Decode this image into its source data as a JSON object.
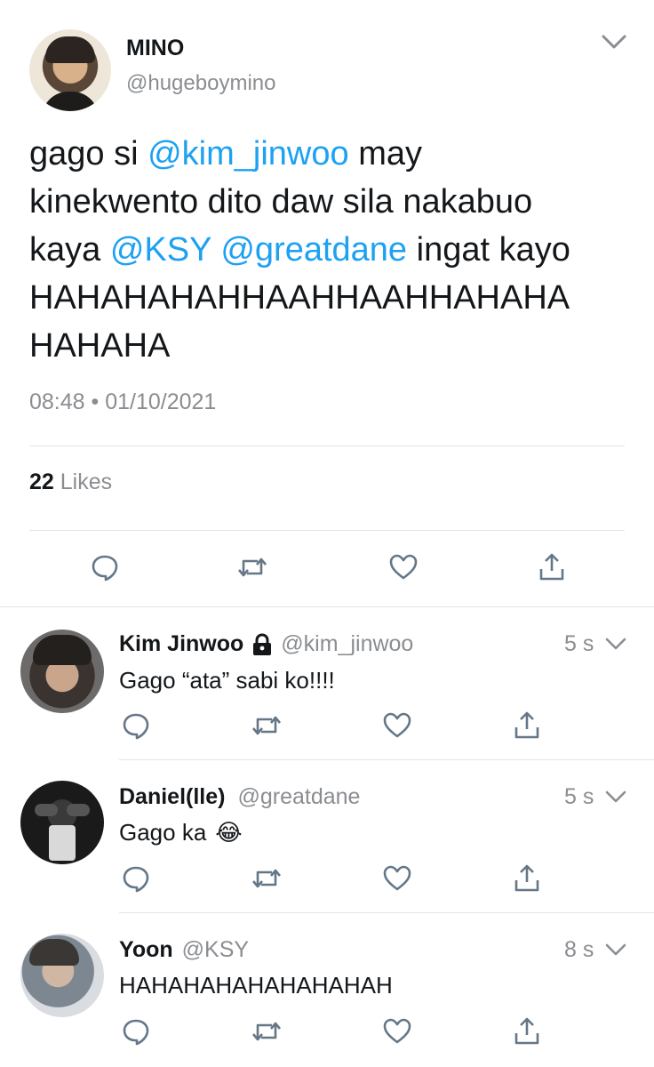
{
  "tweet": {
    "author_name": "MINO",
    "author_handle": "@hugeboymino",
    "text_parts": {
      "p1": "gago si ",
      "m1": "@kim_jinwoo",
      "p2": " may",
      "line2": "kinekwento dito daw sila nakabuo",
      "p3": "kaya ",
      "m2": "@KSY",
      "p4": " ",
      "m3": "@greatdane",
      "p5": " ingat kayo",
      "line4": "HAHAHAHAHHAAHHAAHHAHAHA",
      "line5": "HAHAHA"
    },
    "timestamp": "08:48 • 01/10/2021",
    "likes_count": "22",
    "likes_label": "Likes"
  },
  "replies": [
    {
      "name": "Kim Jinwoo",
      "locked_icon": "lock-icon",
      "handle": "@kim_jinwoo",
      "time": "5 s",
      "text": "Gago “ata” sabi ko!!!!"
    },
    {
      "name": "Daniel(lle)",
      "handle": "@greatdane",
      "time": "5 s",
      "text": "Gago ka",
      "emoji": "😂"
    },
    {
      "name": "Yoon",
      "handle": "@KSY",
      "time": "8 s",
      "text": "HAHAHAHAHAHAHAHAH"
    }
  ],
  "icons": [
    "reply-icon",
    "retweet-icon",
    "like-icon",
    "share-icon",
    "chevron-down-icon"
  ],
  "colors": {
    "link": "#1da1f2",
    "muted": "#8a8d91",
    "icon": "#657786",
    "divider": "#e1e5e8"
  }
}
